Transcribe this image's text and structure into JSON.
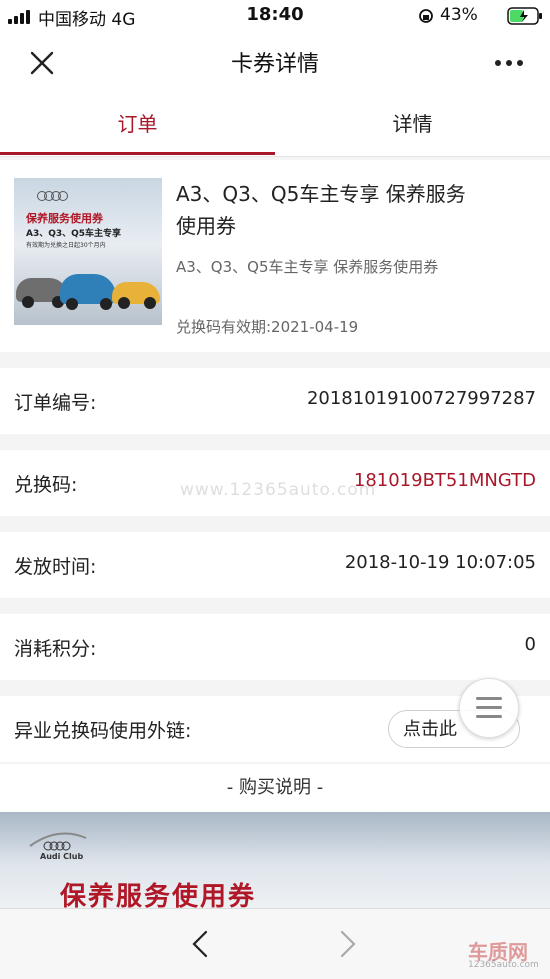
{
  "status": {
    "carrier": "中国移动  4G",
    "time": "18:40",
    "battery": "43%"
  },
  "nav": {
    "title": "卡券详情"
  },
  "tabs": [
    {
      "label": "订单"
    },
    {
      "label": "详情"
    }
  ],
  "product": {
    "thumb_title": "保养服务使用券",
    "thumb_models": "A3、Q3、Q5车主专享",
    "thumb_note": "有效期为兑换之日起30个月内",
    "title": "A3、Q3、Q5车主专享 保养服务使用券",
    "subtitle": "A3、Q3、Q5车主专享 保养服务使用券",
    "validity": "兑换码有效期:2021-04-19"
  },
  "rows": {
    "order_no": {
      "label": "订单编号:",
      "value": "20181019100727997287"
    },
    "code": {
      "label": "兑换码:",
      "value": "181019BT51MNGTD"
    },
    "issue_time": {
      "label": "发放时间:",
      "value": "2018-10-19 10:07:05"
    },
    "points": {
      "label": "消耗积分:",
      "value": "0"
    },
    "ext_link": {
      "label": "异业兑换码使用外链:",
      "button": "点击此"
    }
  },
  "watermark": "www.12365auto.com",
  "buy_title": "- 购买说明 -",
  "banner": {
    "brand": "Audi Club",
    "title": "保养服务使用券"
  },
  "site_logo": {
    "name": "车质网",
    "url": "12365auto.com"
  }
}
